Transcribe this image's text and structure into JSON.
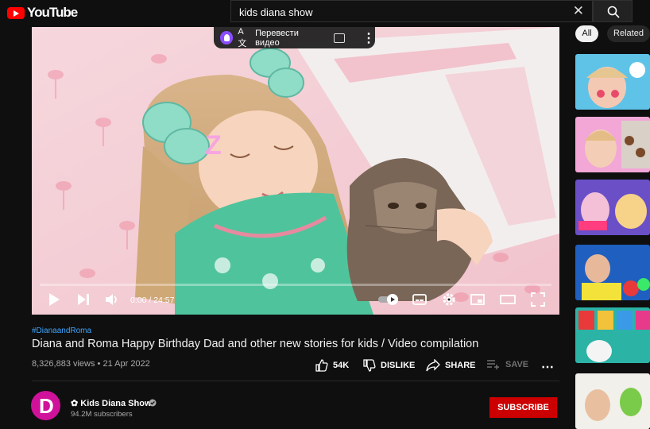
{
  "header": {
    "logo_text": "YouTube",
    "search_value": "kids diana show",
    "search_button_icon": "search-icon",
    "clear_icon": "close-icon"
  },
  "player": {
    "translate_label": "Перевести видео",
    "translate_glyph": "A文",
    "time": "0:00 / 24:57",
    "progress": 0
  },
  "video": {
    "hashtag": "#DianaandRoma",
    "title": "Diana and Roma Happy Birthday Dad and other new stories for kids / Video compilation",
    "views_date": "8,326,883 views • 21 Apr 2022",
    "likes": "54K",
    "dislike_label": "DISLIKE",
    "share_label": "SHARE",
    "save_label": "SAVE"
  },
  "channel": {
    "name": "✿ Kids Diana Show",
    "subscribers": "94.2M subscribers",
    "subscribe_label": "SUBSCRIBE"
  },
  "sidebar": {
    "chips": [
      "All",
      "Related"
    ]
  },
  "colors": {
    "accent_red": "#ff0000",
    "subscribe_red": "#cc0000",
    "link_blue": "#3ea6ff",
    "background": "#0f0f0f"
  }
}
